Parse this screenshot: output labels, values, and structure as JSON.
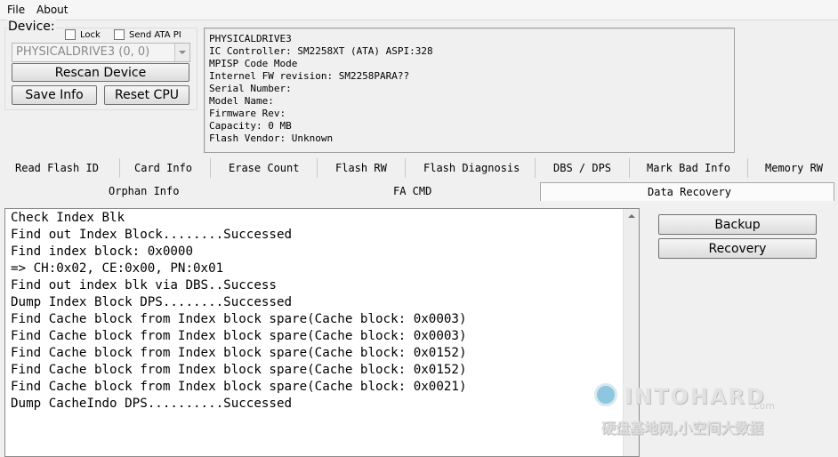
{
  "menu": {
    "file": "File",
    "about": "About"
  },
  "device": {
    "group_label": "Device:",
    "lock_label": "Lock",
    "send_ata_label": "Send ATA PI",
    "selected": "PHYSICALDRIVE3 (0, 0)",
    "rescan_label": "Rescan Device",
    "save_info_label": "Save Info",
    "reset_cpu_label": "Reset CPU"
  },
  "info_lines": [
    "PHYSICALDRIVE3",
    "IC Controller: SM2258XT (ATA) ASPI:328",
    "MPISP Code Mode",
    "Internel FW revision: SM2258PARA??",
    "Serial Number:",
    "Model Name:",
    "Firmware Rev:",
    "Capacity: 0 MB",
    "Flash Vendor: Unknown"
  ],
  "tabs_row1": [
    "Read Flash ID",
    "Card Info",
    "Erase Count",
    "Flash RW",
    "Flash Diagnosis",
    "DBS / DPS",
    "Mark Bad Info",
    "Memory RW"
  ],
  "tabs_row2": [
    "Orphan Info",
    "FA CMD",
    "Data Recovery"
  ],
  "active_tab": "Data Recovery",
  "log_lines": [
    "Check Index Blk",
    "Find out Index Block........Successed",
    "Find index block: 0x0000",
    "=> CH:0x02, CE:0x00, PN:0x01",
    "Find out index blk via DBS..Success",
    "Dump Index Block DPS........Successed",
    "Find Cache block from Index block spare(Cache block: 0x0003)",
    "Find Cache block from Index block spare(Cache block: 0x0003)",
    "Find Cache block from Index block spare(Cache block: 0x0152)",
    "Find Cache block from Index block spare(Cache block: 0x0152)",
    "Find Cache block from Index block spare(Cache block: 0x0021)",
    "Dump CacheIndo DPS..........Successed"
  ],
  "actions": {
    "backup_label": "Backup",
    "recovery_label": "Recovery"
  },
  "watermark": {
    "brand": "INTOHARD",
    "suffix": ".com",
    "subtitle": "硬盘基地网,小空间大数据"
  }
}
